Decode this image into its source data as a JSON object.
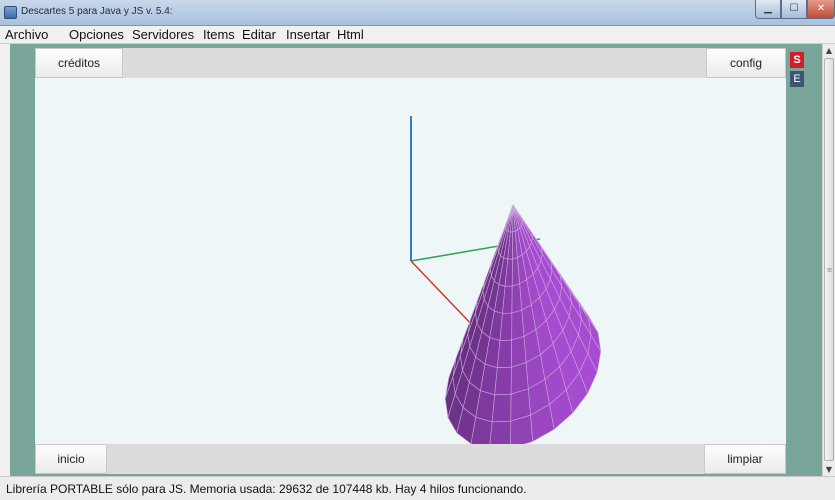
{
  "window": {
    "title": "Descartes 5 para Java y JS v. 5.4:"
  },
  "menubar": {
    "items": [
      "Archivo",
      "Opciones",
      "Servidores",
      "Items",
      "Editar",
      "Insertar",
      "Html"
    ]
  },
  "toolbar_top": {
    "creditos_label": "créditos",
    "config_label": "config"
  },
  "toolbar_bottom": {
    "inicio_label": "inicio",
    "limpiar_label": "limpiar"
  },
  "side_buttons": {
    "s_label": "S",
    "e_label": "E"
  },
  "statusbar": {
    "text": "Librería PORTABLE sólo para JS. Memoria usada: 29632 de 107448 kb. Hay 4 hilos funcionando."
  },
  "scene": {
    "surface_color": "#8a3fae",
    "mesh_color": "#c9a6d9",
    "axis_colors": {
      "z": "#2e7fc0",
      "y": "#2aa15a",
      "x": "#d03a2a"
    }
  }
}
